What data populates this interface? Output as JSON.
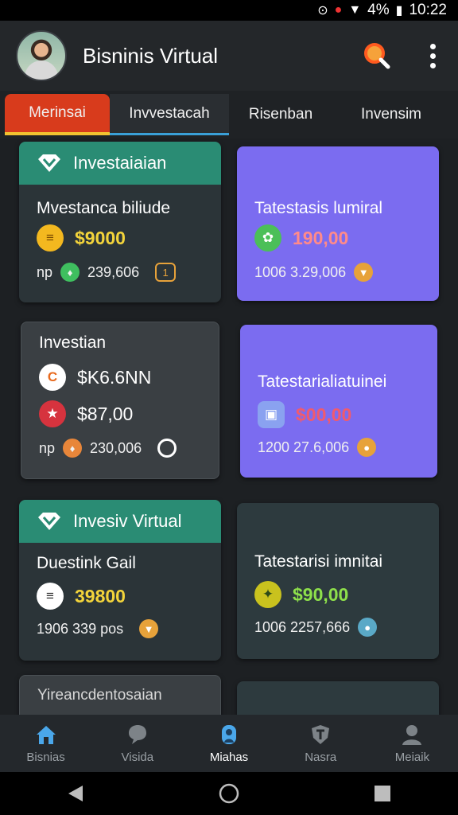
{
  "status": {
    "battery": "4%",
    "time": "10:22"
  },
  "appbar": {
    "title": "Bisninis Virtual",
    "search_icon": "search-icon",
    "more_icon": "more-vertical-icon"
  },
  "tabs": [
    {
      "label": "Merinsai",
      "active": true
    },
    {
      "label": "Invvestacah"
    },
    {
      "label": "Risenban"
    },
    {
      "label": "Invensim"
    }
  ],
  "cards": [
    {
      "header": "Investaiaian",
      "title": "Mvestanca biliude",
      "amount": "$9000",
      "meta_prefix": "np",
      "meta_value": "239,606",
      "meta_badge": "1"
    },
    {
      "title": "Tatestasis lumiral",
      "amount": "190,00",
      "meta_value": "1006  3.29,006"
    },
    {
      "title": "Investian",
      "amount1": "$K6.6NN",
      "amount2": "$87,00",
      "meta_prefix": "np",
      "meta_value": "230,006"
    },
    {
      "title": "Tatestarialiatuinei",
      "amount": "$00,00",
      "meta_value": "1200  27.6,006"
    },
    {
      "header": "Invesiv Virtual",
      "title": "Duestink Gail",
      "amount": "39800",
      "meta_value": "1906  339 pos"
    },
    {
      "title": "Tatestarisi imnitai",
      "amount": "$90,00",
      "meta_value": "1006  2257,666"
    },
    {
      "title": "Yireancdentosaian"
    }
  ],
  "bottom_nav": [
    {
      "label": "Bisnias",
      "icon": "home-icon"
    },
    {
      "label": "Visida",
      "icon": "chat-icon"
    },
    {
      "label": "Miahas",
      "icon": "person-icon",
      "active": true
    },
    {
      "label": "Nasra",
      "icon": "shield-icon"
    },
    {
      "label": "Meiaik",
      "icon": "profile-icon"
    }
  ],
  "colors": {
    "accent_tab": "#d83b1c",
    "teal_header": "#2a8c74",
    "purple_card": "#7b6cf0",
    "amount_yellow": "#f3d43b",
    "amount_red": "#e24a57",
    "amount_green": "#8ee04b"
  }
}
